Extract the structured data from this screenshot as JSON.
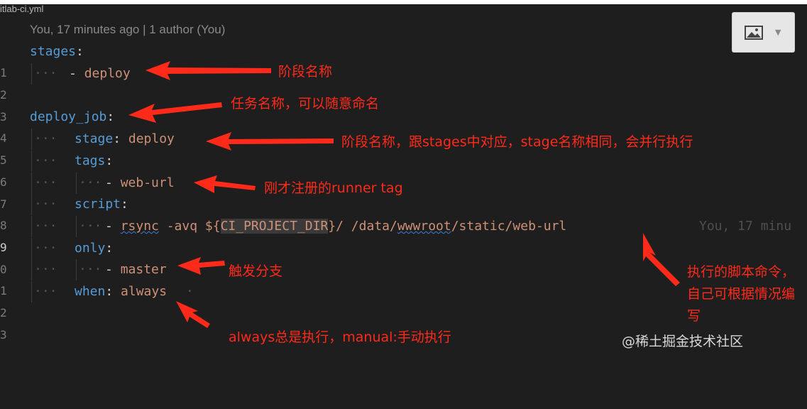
{
  "file": {
    "name": "itlab-ci.yml",
    "blame": "You, 17 minutes ago | 1 author (You)"
  },
  "toolbar": {
    "image_icon": "image-icon",
    "caret_icon": "chevron-down-icon"
  },
  "line_numbers": [
    "1",
    "2",
    "3",
    "4",
    "5",
    "6",
    "7",
    "8",
    "9",
    "0",
    "1",
    "2",
    "3"
  ],
  "code": {
    "l1_key": "stages",
    "l1_colon": ":",
    "l2_dash": "- ",
    "l2_val": "deploy",
    "l4_key": "deploy_job",
    "l4_colon": ":",
    "l5_key": "stage",
    "l5_colon": ": ",
    "l5_val": "deploy",
    "l6_key": "tags",
    "l6_colon": ":",
    "l7_dash": "- ",
    "l7_val": "web-url",
    "l8_key": "script",
    "l8_colon": ":",
    "l9_dash": "- ",
    "l9_cmd": "rsync",
    "l9_flag": " -avq ${",
    "l9_var": "CI_PROJECT_DIR",
    "l9_rest1": "}/ /data/",
    "l9_www": "wwwroot",
    "l9_rest2": "/static/web-url",
    "l9_ghost": "You, 17 minu",
    "l10_key": "only",
    "l10_colon": ":",
    "l11_dash": "- ",
    "l11_val": "master",
    "l12_key": "when",
    "l12_colon": ": ",
    "l12_val": "always"
  },
  "annotations": {
    "a1": "阶段名称",
    "a2": "任务名称，可以随意命名",
    "a3": "阶段名称，跟stages中对应，stage名称相同，会并行执行",
    "a4": "刚才注册的runner tag",
    "a5": "触发分支",
    "a6": "执行的脚本命令，自己可根据情况编写",
    "a7": "always总是执行，manual:手动执行"
  },
  "watermark": "@稀土掘金技术社区",
  "colors": {
    "annotation": "#ff2a1a",
    "key": "#569cd6",
    "value": "#ce9178",
    "background": "#1e1e1e"
  }
}
